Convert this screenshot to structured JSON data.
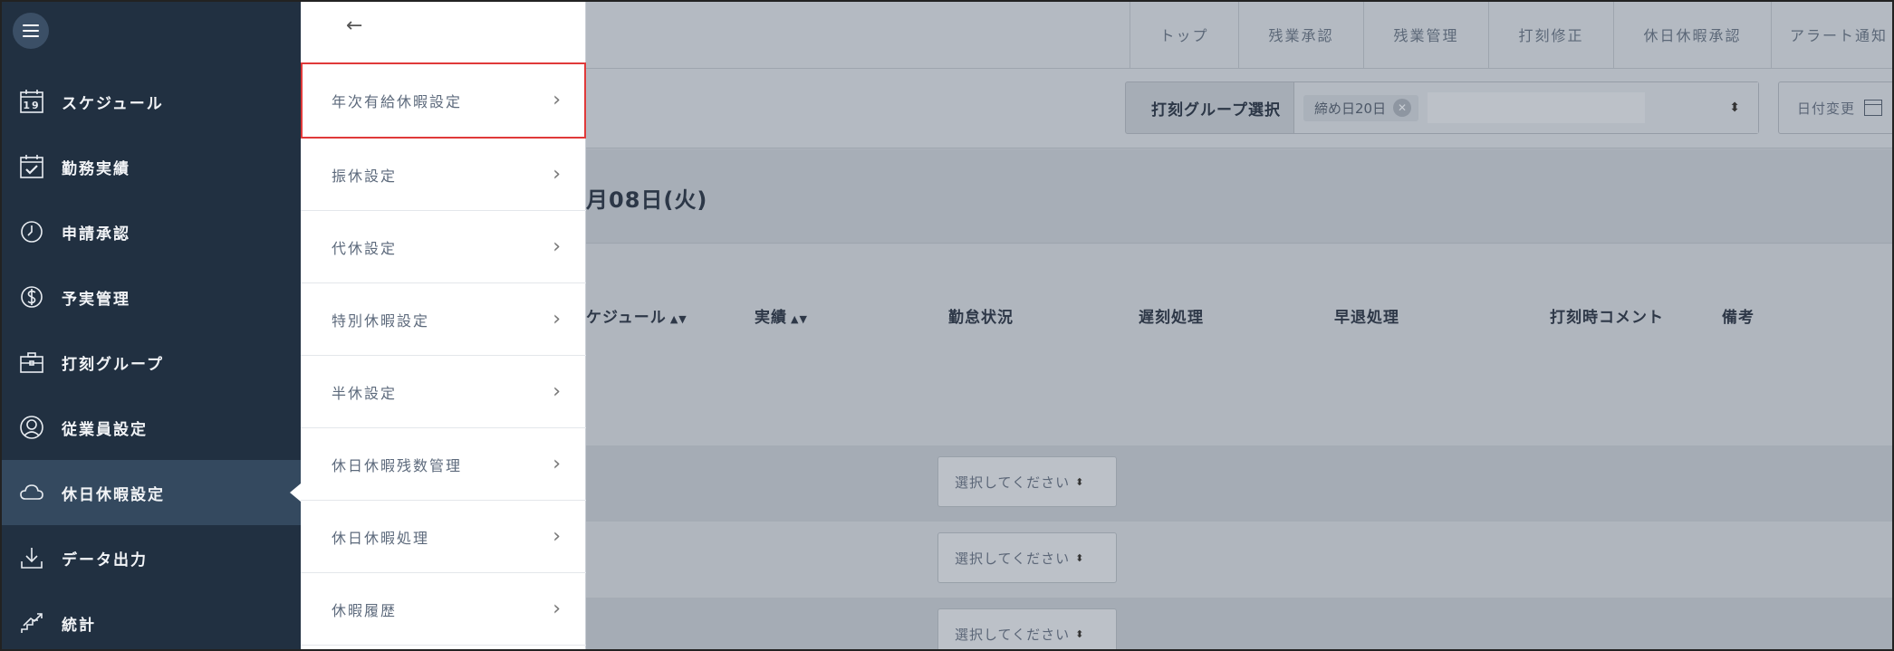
{
  "sidebar": {
    "items": [
      {
        "label": "スケジュール",
        "icon": "calendar-icon"
      },
      {
        "label": "勤務実績",
        "icon": "calendar-check-icon"
      },
      {
        "label": "申請承認",
        "icon": "clock-icon"
      },
      {
        "label": "予実管理",
        "icon": "dollar-icon"
      },
      {
        "label": "打刻グループ",
        "icon": "briefcase-icon"
      },
      {
        "label": "従業員設定",
        "icon": "user-icon"
      },
      {
        "label": "休日休暇設定",
        "icon": "cloud-icon",
        "active": true
      },
      {
        "label": "データ出力",
        "icon": "download-icon"
      },
      {
        "label": "統計",
        "icon": "chart-icon"
      }
    ],
    "calendar_day": "19"
  },
  "submenu": {
    "back_icon": "←",
    "items": [
      {
        "label": "年次有給休暇設定",
        "highlighted": true
      },
      {
        "label": "振休設定"
      },
      {
        "label": "代休設定"
      },
      {
        "label": "特別休暇設定"
      },
      {
        "label": "半休設定"
      },
      {
        "label": "休日休暇残数管理"
      },
      {
        "label": "休日休暇処理"
      },
      {
        "label": "休暇履歴"
      }
    ],
    "chevron": "›"
  },
  "topbar": {
    "tabs": [
      "トップ",
      "残業承認",
      "残業管理",
      "打刻修正",
      "休日休暇承認",
      "アラート通知"
    ]
  },
  "filter": {
    "group_label": "打刻グループ選択",
    "chip": "締め日20日",
    "date_button": "日付変更"
  },
  "date_banner": {
    "text": "月08日(火)"
  },
  "table": {
    "headers": [
      {
        "label": "ケジュール",
        "sortable": true
      },
      {
        "label": "実績",
        "sortable": true
      },
      {
        "label": "勤怠状況",
        "sortable": false
      },
      {
        "label": "遅刻処理",
        "sortable": false
      },
      {
        "label": "早退処理",
        "sortable": false
      },
      {
        "label": "打刻時コメント",
        "sortable": false
      },
      {
        "label": "備考",
        "sortable": false
      }
    ],
    "row_select_placeholder": "選択してください"
  },
  "colors": {
    "sidebar_bg": "#213041",
    "sidebar_active": "#34495f",
    "highlight_border": "#e03a3a",
    "overlay_bg": "#aeb4bd"
  }
}
